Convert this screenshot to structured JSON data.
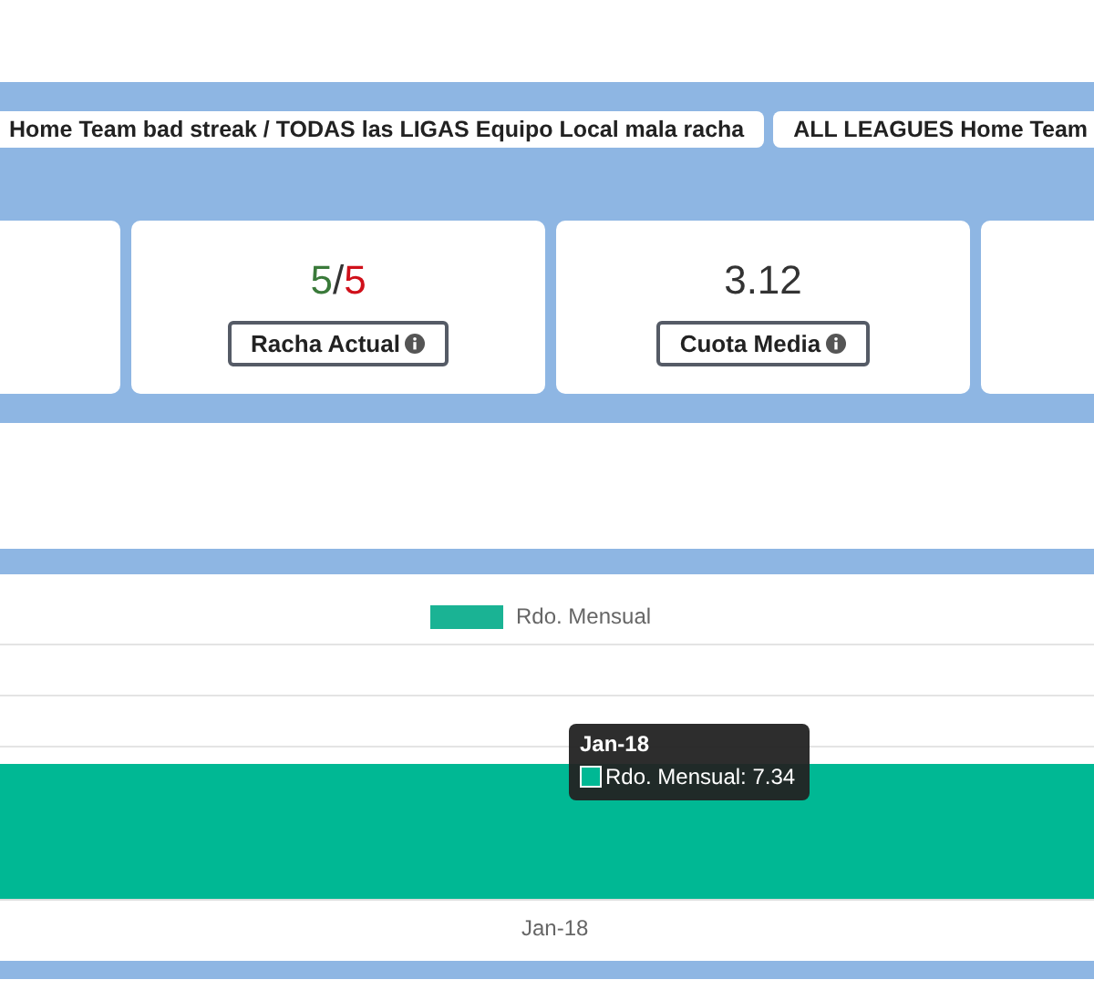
{
  "tabs": [
    {
      "label": "Home Team bad streak / TODAS las LIGAS Equipo Local mala racha"
    },
    {
      "label": "ALL LEAGUES Home Team"
    }
  ],
  "stats": [
    {
      "kind": "empty"
    },
    {
      "kind": "streak",
      "current": "5",
      "separator": "/",
      "total": "5",
      "label": "Racha Actual"
    },
    {
      "kind": "value",
      "value": "3.12",
      "label": "Cuota Media"
    },
    {
      "kind": "empty"
    }
  ],
  "chart": {
    "legend": "Rdo. Mensual",
    "x_label": "Jan-18",
    "tooltip": {
      "title": "Jan-18",
      "body": "Rdo. Mensual: 7.34"
    }
  }
}
